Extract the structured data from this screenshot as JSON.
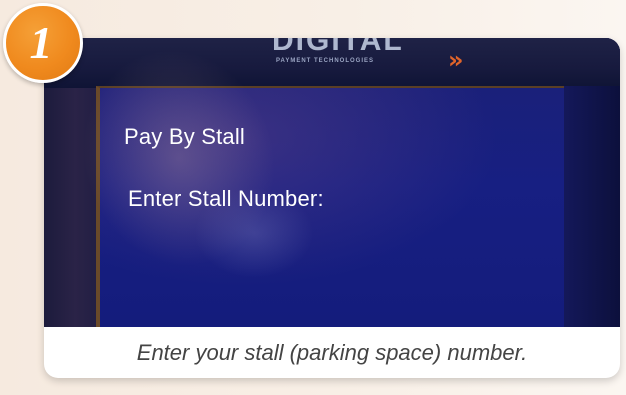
{
  "step": {
    "number": "1"
  },
  "photo": {
    "logo_text": "DIGITAL",
    "logo_arrow": "»",
    "logo_subtitle": "PAYMENT TECHNOLOGIES",
    "screen_title": "Pay By Stall",
    "screen_prompt": "Enter Stall Number:"
  },
  "caption": "Enter your stall (parking space) number.",
  "colors": {
    "badge_orange": "#f08a1e",
    "screen_blue": "#171f82",
    "caption_text": "#444444"
  }
}
